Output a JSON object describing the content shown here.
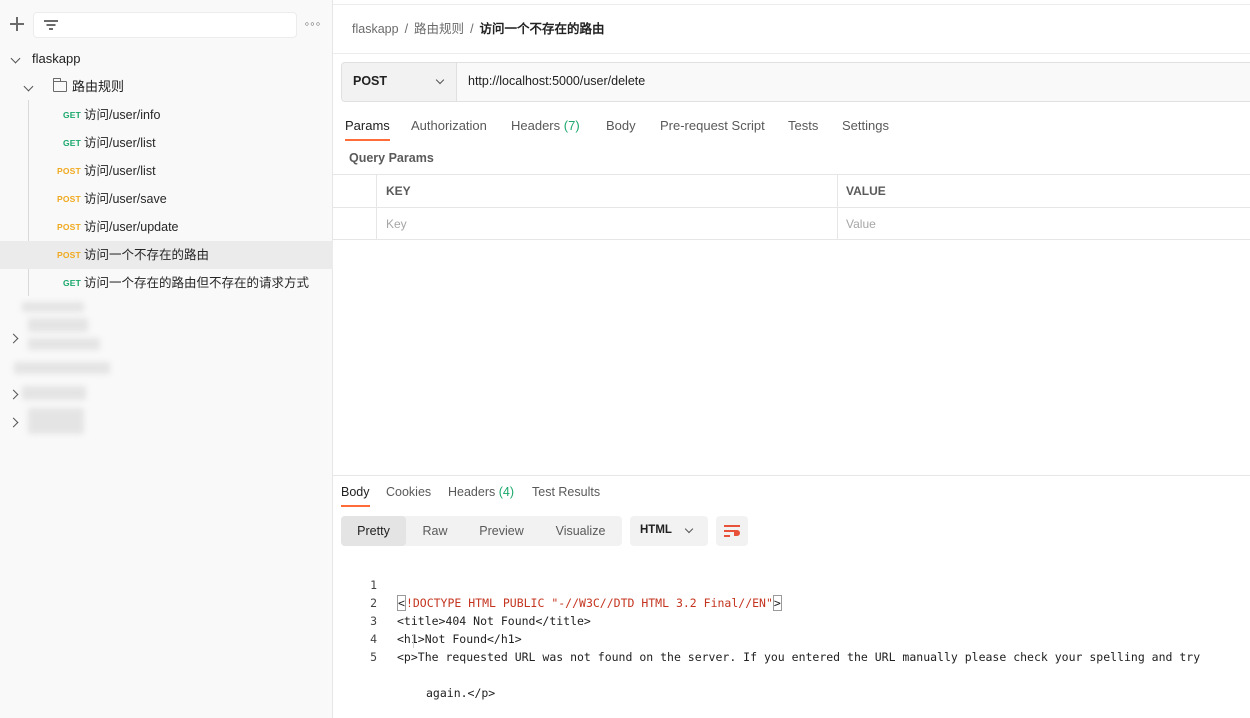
{
  "sidebar": {
    "more_label": "◦◦◦",
    "collection": {
      "name": "flaskapp"
    },
    "folder": {
      "name": "路由规则"
    },
    "requests": [
      {
        "method": "GET",
        "name": "访问/user/info"
      },
      {
        "method": "GET",
        "name": "访问/user/list"
      },
      {
        "method": "POST",
        "name": "访问/user/list"
      },
      {
        "method": "POST",
        "name": "访问/user/save"
      },
      {
        "method": "POST",
        "name": "访问/user/update"
      },
      {
        "method": "POST",
        "name": "访问一个不存在的路由",
        "selected": true
      },
      {
        "method": "GET",
        "name": "访问一个存在的路由但不存在的请求方式"
      }
    ]
  },
  "breadcrumb": {
    "items": [
      "flaskapp",
      "路由规则"
    ],
    "separator": "/",
    "current": "访问一个不存在的路由"
  },
  "request": {
    "method": "POST",
    "url": "http://localhost:5000/user/delete",
    "tabs": [
      {
        "label": "Params",
        "active": true
      },
      {
        "label": "Authorization"
      },
      {
        "label": "Headers",
        "count": "(7)"
      },
      {
        "label": "Body"
      },
      {
        "label": "Pre-request Script"
      },
      {
        "label": "Tests"
      },
      {
        "label": "Settings"
      }
    ],
    "query_params_title": "Query Params",
    "table": {
      "key_header": "KEY",
      "value_header": "VALUE",
      "key_placeholder": "Key",
      "value_placeholder": "Value"
    }
  },
  "response": {
    "tabs": [
      {
        "label": "Body",
        "active": true
      },
      {
        "label": "Cookies"
      },
      {
        "label": "Headers",
        "count": "(4)"
      },
      {
        "label": "Test Results"
      }
    ],
    "view_modes": [
      "Pretty",
      "Raw",
      "Preview",
      "Visualize"
    ],
    "active_view": "Pretty",
    "language": "HTML",
    "code_lines": [
      {
        "n": "1",
        "a": "<",
        "b": "!DOCTYPE HTML PUBLIC \"-//W3C//DTD HTML 3.2 Final//EN\"",
        "c": ">"
      },
      {
        "n": "2",
        "text": "<title>404 Not Found</title>"
      },
      {
        "n": "3",
        "text": "<h1>Not Found</h1>"
      },
      {
        "n": "4",
        "text": "<p>The requested URL was not found on the server. If you entered the URL manually please check your spelling and try"
      },
      {
        "n": "5",
        "text": "again.</p>"
      }
    ]
  },
  "colors": {
    "accent": "#ff6c37",
    "get": "#1aa86b",
    "post": "#f0a91e",
    "count": "#1aa86b",
    "doctype": "#c4341f"
  }
}
